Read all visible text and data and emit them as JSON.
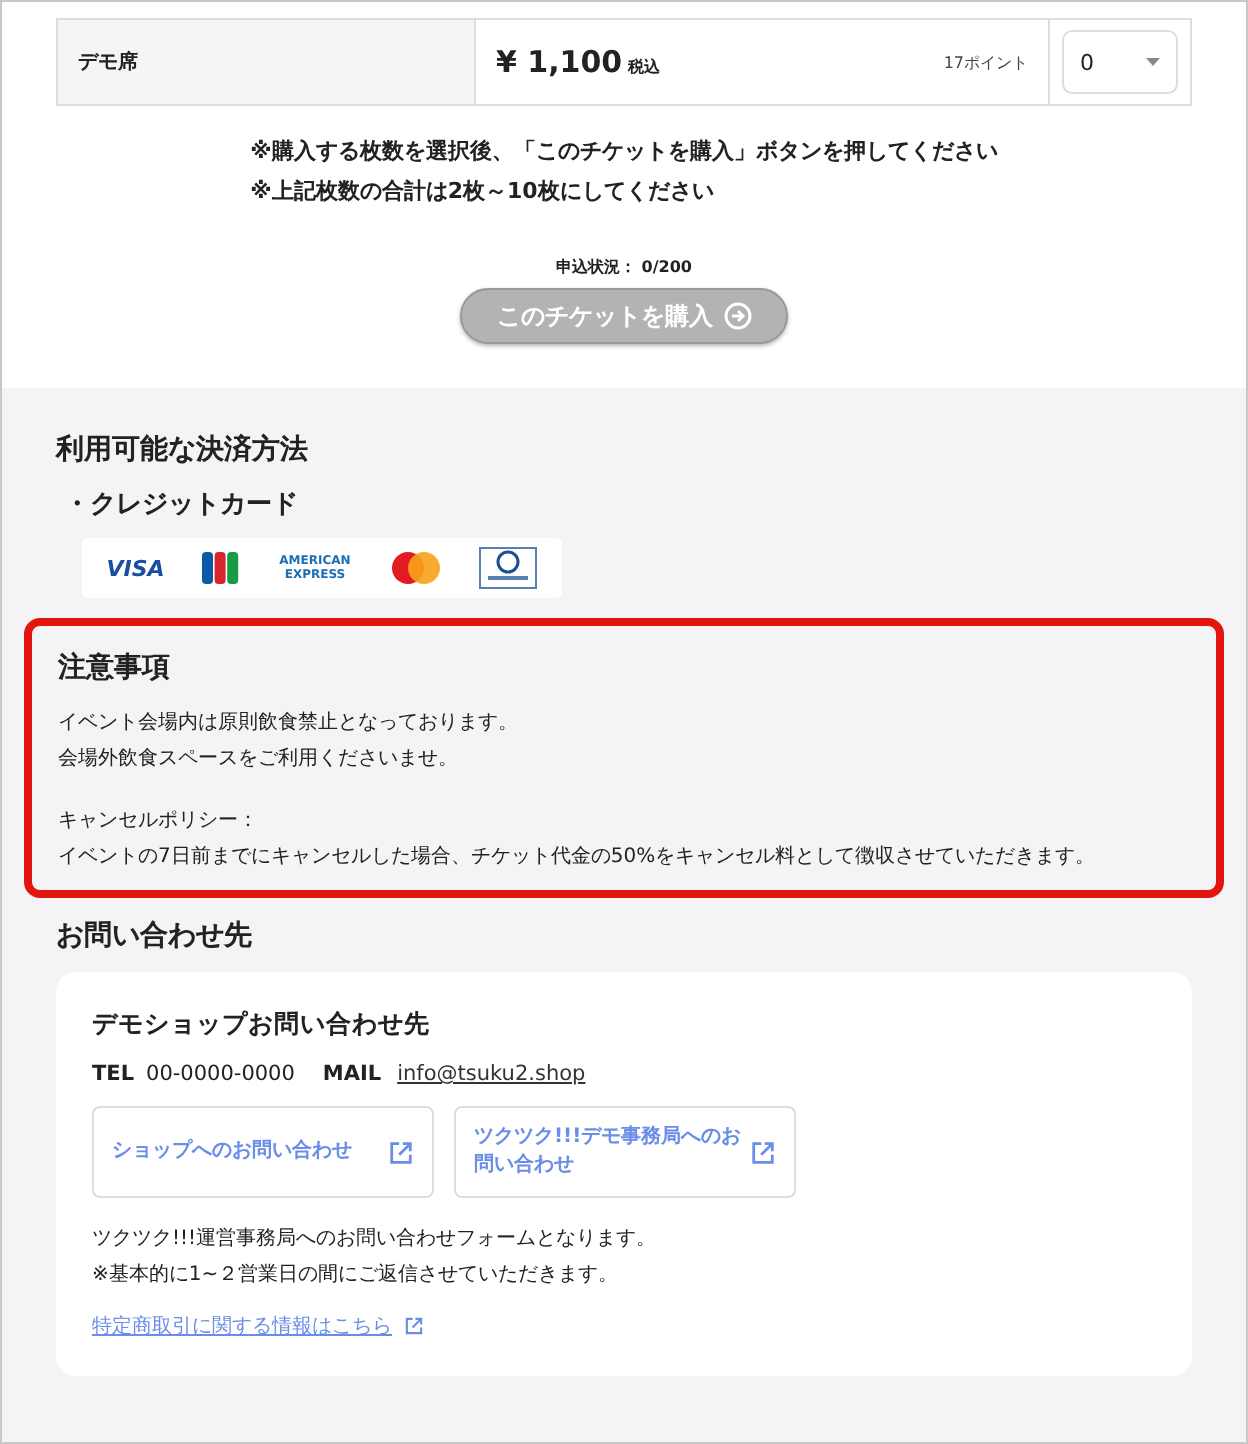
{
  "ticket_row": {
    "name": "デモ席",
    "price": "¥ 1,100",
    "tax_label": "税込",
    "points": "17ポイント",
    "quantity": "0"
  },
  "notes": [
    "※購入する枚数を選択後、「このチケットを購入」ボタンを押してください",
    "※上記枚数の合計は2枚～10枚にしてください"
  ],
  "application_status": "申込状況： 0/200",
  "buy_button": {
    "label": "このチケットを購入",
    "disabled": true
  },
  "payment": {
    "title": "利用可能な決済方法",
    "method": "・クレジットカード",
    "cards": [
      {
        "kind": "visa",
        "text": "VISA"
      },
      {
        "kind": "jcb"
      },
      {
        "kind": "amex",
        "text": "AMERICAN EXPRESS"
      },
      {
        "kind": "mastercard"
      },
      {
        "kind": "diners"
      }
    ]
  },
  "notice": {
    "title": "注意事項",
    "paragraphs": [
      [
        "イベント会場内は原則飲食禁止となっております。",
        "会場外飲食スペースをご利用くださいませ。"
      ],
      [
        "キャンセルポリシー：",
        "イベントの7日前までにキャンセルした場合、チケット代金の50%をキャンセル料として徴収させていただきます。"
      ]
    ]
  },
  "contact": {
    "title": "お問い合わせ先",
    "shop_name": "デモショップお問い合わせ先",
    "tel_label": "TEL",
    "tel": "00-0000-0000",
    "mail_label": "MAIL",
    "mail": "info@tsuku2.shop",
    "buttons": [
      "ショップへのお問い合わせ",
      "ツクツク!!!デモ事務局へのお問い合わせ"
    ],
    "description": [
      "ツクツク!!!運営事務局へのお問い合わせフォームとなります。",
      "※基本的に1~２営業日の間にご返信させていただきます。"
    ],
    "legal_link": "特定商取引に関する情報はこちら"
  }
}
